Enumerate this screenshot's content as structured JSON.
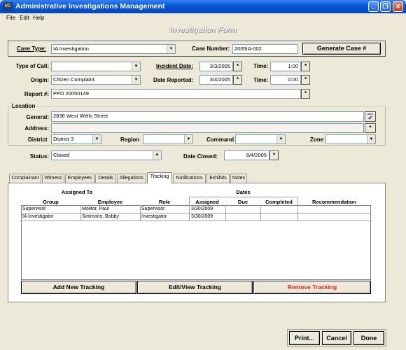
{
  "window": {
    "title": "Administrative Investigations Management",
    "icon_text": "WS"
  },
  "menu": [
    "File",
    "Edit",
    "Help"
  ],
  "form_title": "Investigation Form",
  "case": {
    "type_label": "Case Type:",
    "type_value": "IA Investigation",
    "number_label": "Case Number:",
    "number_value": "2005IA-002",
    "generate_button": "Generate Case #"
  },
  "call": {
    "type_label": "Type of Call:",
    "type_value": "",
    "incident_label": "Incident Date:",
    "incident_value": "3/3/2005",
    "time_label_1": "Time:",
    "time_value_1": "1:00",
    "origin_label": "Origin:",
    "origin_value": "Citizen Complaint",
    "reported_label": "Date Reported:",
    "reported_value": "3/4/2005",
    "time_label_2": "Time:",
    "time_value_2": "0:00",
    "report_label": "Report #:",
    "report_value": "PPD 20050149"
  },
  "location": {
    "group_label": "Location",
    "general_label": "General:",
    "general_value": "2836 West Wells Street",
    "address_label": "Address:",
    "address_value": "",
    "geo_button": "ABC",
    "district_label": "District",
    "district_value": "District 3",
    "region_label": "Region",
    "region_value": "",
    "command_label": "Command",
    "command_value": "",
    "zone_label": "Zone",
    "zone_value": ""
  },
  "status": {
    "status_label": "Status:",
    "status_value": "Closed",
    "closed_label": "Date Closed:",
    "closed_value": "8/4/2005"
  },
  "tabs": [
    "Complainant",
    "Witness",
    "Employees",
    "Details",
    "Allegations",
    "Tracking",
    "Notifications",
    "Exhibits",
    "Notes"
  ],
  "active_tab": "Tracking",
  "tracking": {
    "assigned_to": "Assigned To",
    "dates": "Dates",
    "columns": [
      "Group",
      "Employee",
      "Role",
      "Assigned",
      "Due",
      "Completed",
      "Recommendation"
    ],
    "rows": [
      [
        "Supervisor",
        "Molitor, Paul",
        "Supervisor",
        "3/30/2009",
        "",
        "",
        ""
      ],
      [
        "IA Investigator",
        "Simmons, Bobby",
        "Investigator",
        "3/30/2009",
        "",
        "",
        ""
      ]
    ],
    "add_button": "Add New Tracking",
    "edit_button": "Edit/View Tracking",
    "remove_button": "Remove Tracking",
    "remove_color": "#e8201c"
  },
  "footer": {
    "print": "Print...",
    "cancel": "Cancel",
    "done": "Done"
  },
  "colors": {
    "title_bar": "#0a5bd8",
    "background": "#ece9d8"
  }
}
